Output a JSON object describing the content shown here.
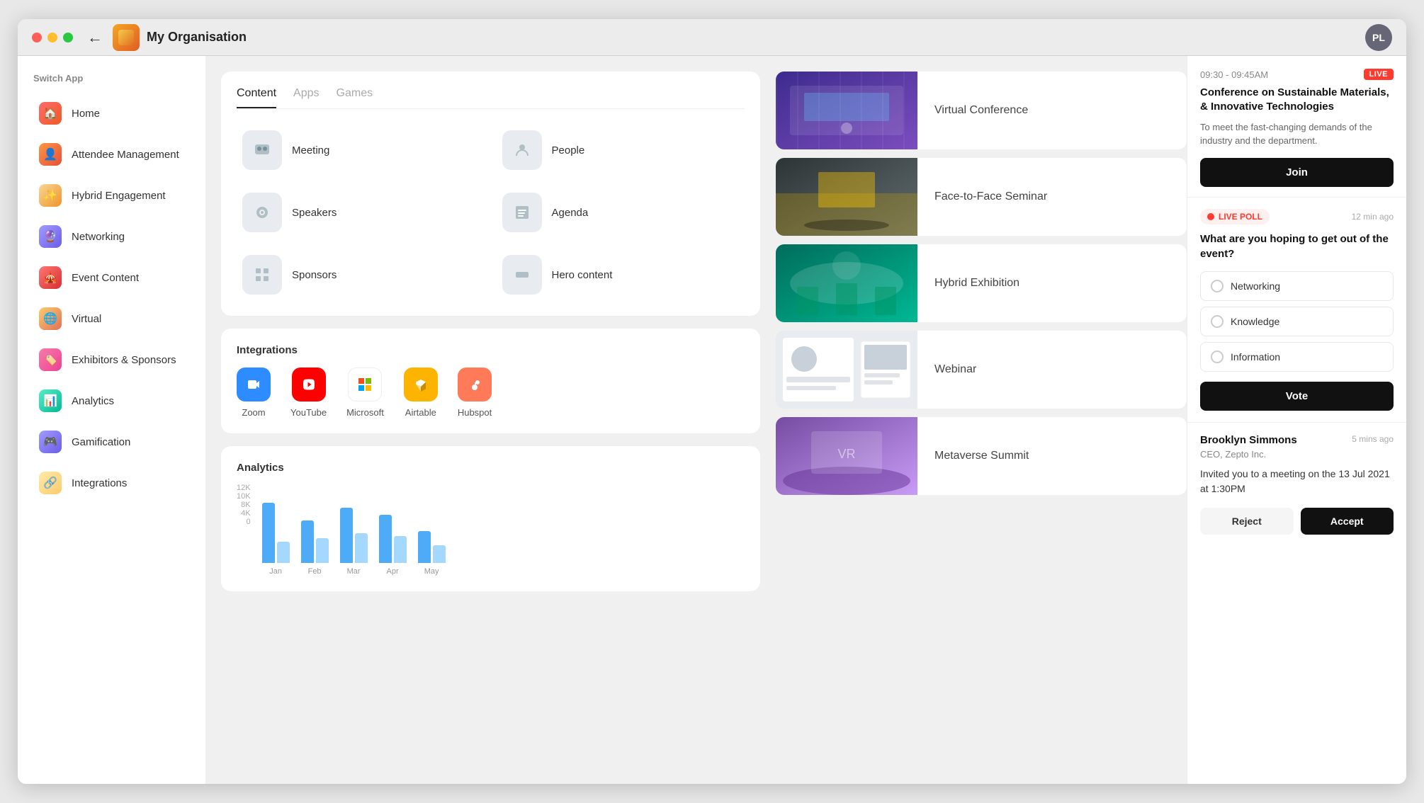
{
  "window": {
    "title": "My Organisation",
    "user_initials": "PL"
  },
  "sidebar": {
    "header": "Switch App",
    "items": [
      {
        "id": "home",
        "label": "Home",
        "icon": "🏠"
      },
      {
        "id": "attendee-management",
        "label": "Attendee Management",
        "icon": "👤"
      },
      {
        "id": "hybrid-engagement",
        "label": "Hybrid Engagement",
        "icon": "✨"
      },
      {
        "id": "networking",
        "label": "Networking",
        "icon": "🔮"
      },
      {
        "id": "event-content",
        "label": "Event Content",
        "icon": "🎪"
      },
      {
        "id": "virtual",
        "label": "Virtual",
        "icon": "🌐"
      },
      {
        "id": "exhibitors-sponsors",
        "label": "Exhibitors & Sponsors",
        "icon": "🏷️"
      },
      {
        "id": "analytics",
        "label": "Analytics",
        "icon": "📊"
      },
      {
        "id": "gamification",
        "label": "Gamification",
        "icon": "🎮"
      },
      {
        "id": "integrations",
        "label": "Integrations",
        "icon": "🔗"
      }
    ]
  },
  "content_card": {
    "tabs": [
      "Content",
      "Apps",
      "Games"
    ],
    "active_tab": "Content",
    "items": [
      {
        "id": "meeting",
        "label": "Meeting",
        "icon": "👥"
      },
      {
        "id": "people",
        "label": "People",
        "icon": "🙋"
      },
      {
        "id": "speakers",
        "label": "Speakers",
        "icon": "🎧"
      },
      {
        "id": "agenda",
        "label": "Agenda",
        "icon": "📋"
      },
      {
        "id": "sponsors",
        "label": "Sponsors",
        "icon": "⊞"
      },
      {
        "id": "hero-content",
        "label": "Hero content",
        "icon": "▬"
      }
    ]
  },
  "integrations": {
    "label": "Integrations",
    "items": [
      {
        "id": "zoom",
        "label": "Zoom",
        "color": "#2D8CFF"
      },
      {
        "id": "youtube",
        "label": "YouTube",
        "color": "#FF0000"
      },
      {
        "id": "microsoft",
        "label": "Microsoft",
        "color": "#f0f0f0"
      },
      {
        "id": "airtable",
        "label": "Airtable",
        "color": "#FCB400"
      },
      {
        "id": "hubspot",
        "label": "Hubspot",
        "color": "#FF7A59"
      }
    ]
  },
  "analytics": {
    "label": "Analytics",
    "y_axis": [
      "12K",
      "10K",
      "8K",
      "4K",
      "0"
    ],
    "bars": [
      {
        "month": "Jan",
        "dark": 85,
        "light": 30
      },
      {
        "month": "Feb",
        "dark": 60,
        "light": 35
      },
      {
        "month": "Mar",
        "dark": 78,
        "light": 42
      },
      {
        "month": "Apr",
        "dark": 68,
        "light": 38
      },
      {
        "month": "May",
        "dark": 45,
        "light": 25
      }
    ]
  },
  "events": [
    {
      "id": "virtual-conference",
      "title": "Virtual Conference",
      "thumb_type": "vc"
    },
    {
      "id": "face-to-face-seminar",
      "title": "Face-to-Face Seminar",
      "thumb_type": "face"
    },
    {
      "id": "hybrid-exhibition",
      "title": "Hybrid Exhibition",
      "thumb_type": "hybrid"
    },
    {
      "id": "webinar",
      "title": "Webinar",
      "thumb_type": "webinar"
    },
    {
      "id": "metaverse-summit",
      "title": "Metaverse Summit",
      "thumb_type": "meta"
    }
  ],
  "right_panel": {
    "session": {
      "time": "09:30 - 09:45AM",
      "live_label": "LIVE",
      "title": "Conference on Sustainable Materials, & Innovative Technologies",
      "description": "To meet the fast-changing demands of the industry and the department.",
      "join_label": "Join"
    },
    "poll": {
      "badge_label": "LIVE POLL",
      "time_ago": "12 min ago",
      "question": "What are you hoping to get out of the event?",
      "options": [
        {
          "id": "networking",
          "label": "Networking"
        },
        {
          "id": "knowledge",
          "label": "Knowledge"
        },
        {
          "id": "information",
          "label": "Information"
        }
      ],
      "vote_label": "Vote"
    },
    "meeting": {
      "name": "Brooklyn Simmons",
      "role": "CEO, Zepto Inc.",
      "time_ago": "5 mins ago",
      "description": "Invited you to a meeting on the 13 Jul 2021 at 1:30PM",
      "reject_label": "Reject",
      "accept_label": "Accept"
    }
  }
}
